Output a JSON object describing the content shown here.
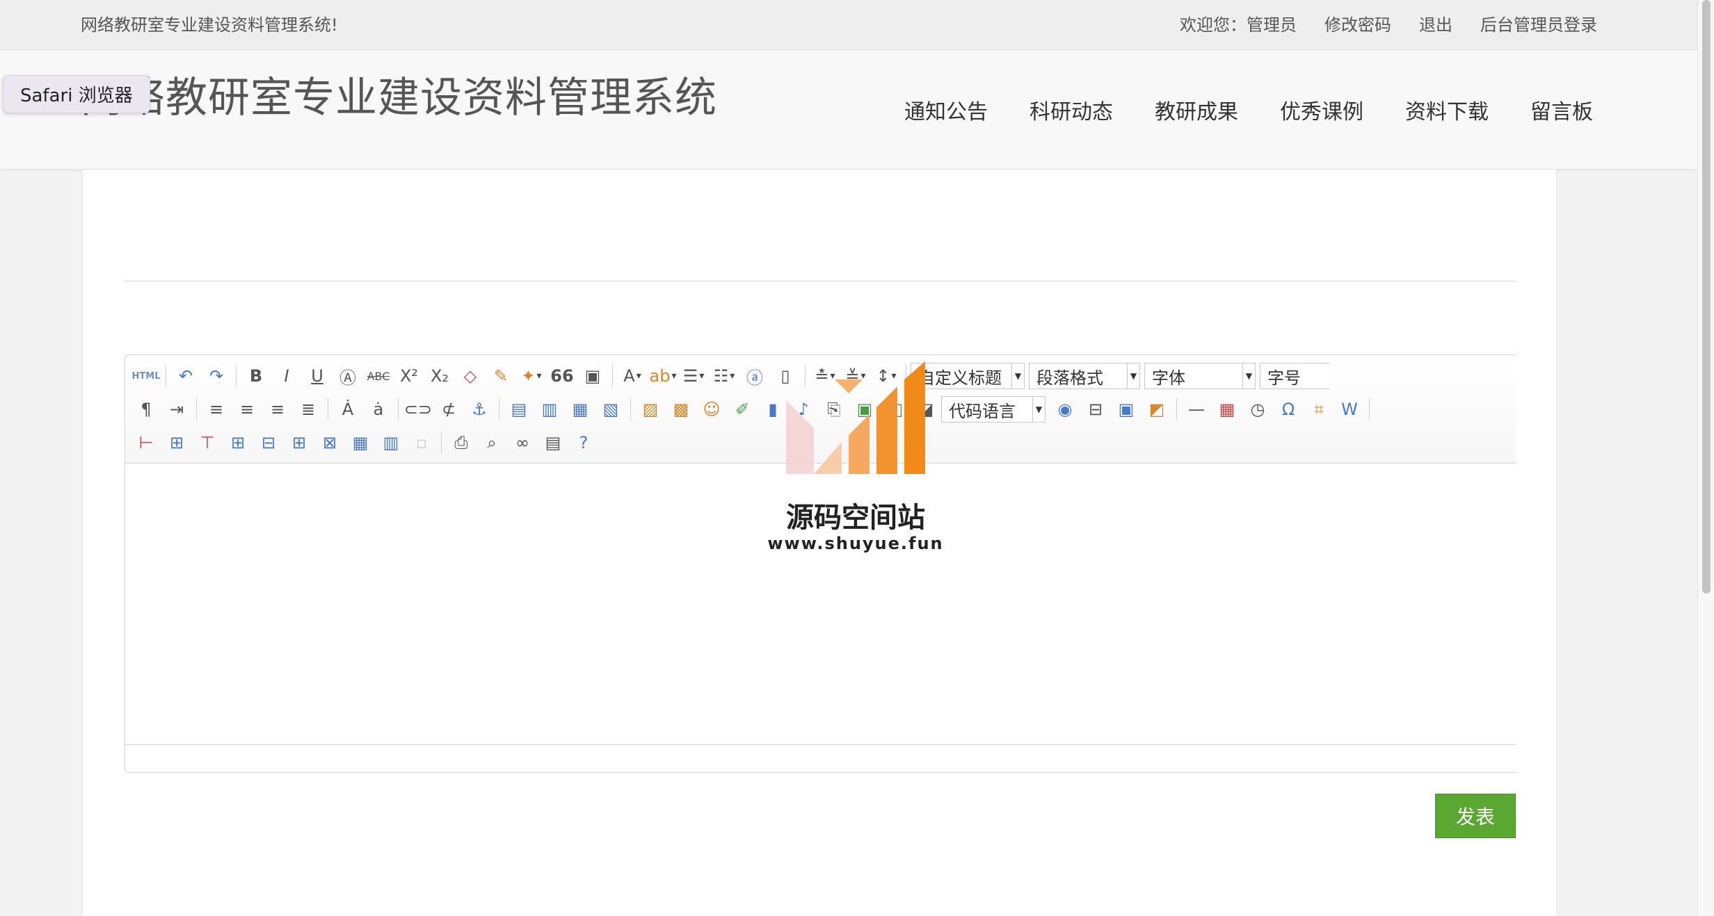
{
  "topbar": {
    "site_tip": "网络教研室专业建设资料管理系统!",
    "links": [
      "欢迎您：管理员",
      "修改密码",
      "退出",
      "后台管理员登录"
    ]
  },
  "header": {
    "title": "网络教研室专业建设资料管理系统",
    "nav": [
      "通知公告",
      "科研动态",
      "教研成果",
      "优秀课例",
      "资料下载",
      "留言板"
    ]
  },
  "safari_tooltip": "Safari 浏览器",
  "editor": {
    "toolbar": {
      "html_label": "HTML",
      "selects": {
        "custom_heading": "自定义标题",
        "paragraph_format": "段落格式",
        "font_family": "字体",
        "font_size": "字号",
        "code_language": "代码语言"
      },
      "glyphs": {
        "bold": "B",
        "italic": "I",
        "underline": "U",
        "quote": "66",
        "font_color": "A"
      }
    }
  },
  "submit_label": "发表",
  "watermark": {
    "name": "源码空间站",
    "url": "www.shuyue.fun"
  },
  "colors": {
    "submit_bg": "#5aa832",
    "watermark_orange": "#f28a1a",
    "watermark_pink": "#f5c4c4"
  }
}
